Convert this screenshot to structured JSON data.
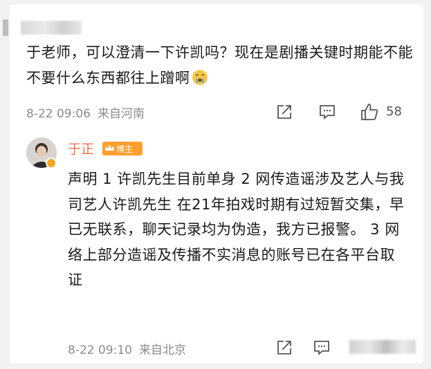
{
  "comment": {
    "text": "于老师，可以澄清一下许凯吗？现在是剧播关键时期能不能不要什么东西都往上蹭啊",
    "time": "8-22 09:06",
    "location": "来自河南",
    "like_count": "58",
    "emoji": "crying-face-icon"
  },
  "reply": {
    "author": "于正",
    "badge": "博主",
    "text": "声明 1 许凯先生目前单身 2 网传造谣涉及艺人与我司艺人许凯先生 在21年拍戏时期有过短暂交集，早已无联系，聊天记录均为伪造，我方已报警。 3 网络上部分造谣及传播不实消息的账号已在各平台取证",
    "time": "8-22 09:10",
    "location": "来自北京"
  },
  "colors": {
    "author_name": "#eb7350",
    "badge_bg": "#ff9f2d",
    "meta_text": "#8c8c8c"
  }
}
